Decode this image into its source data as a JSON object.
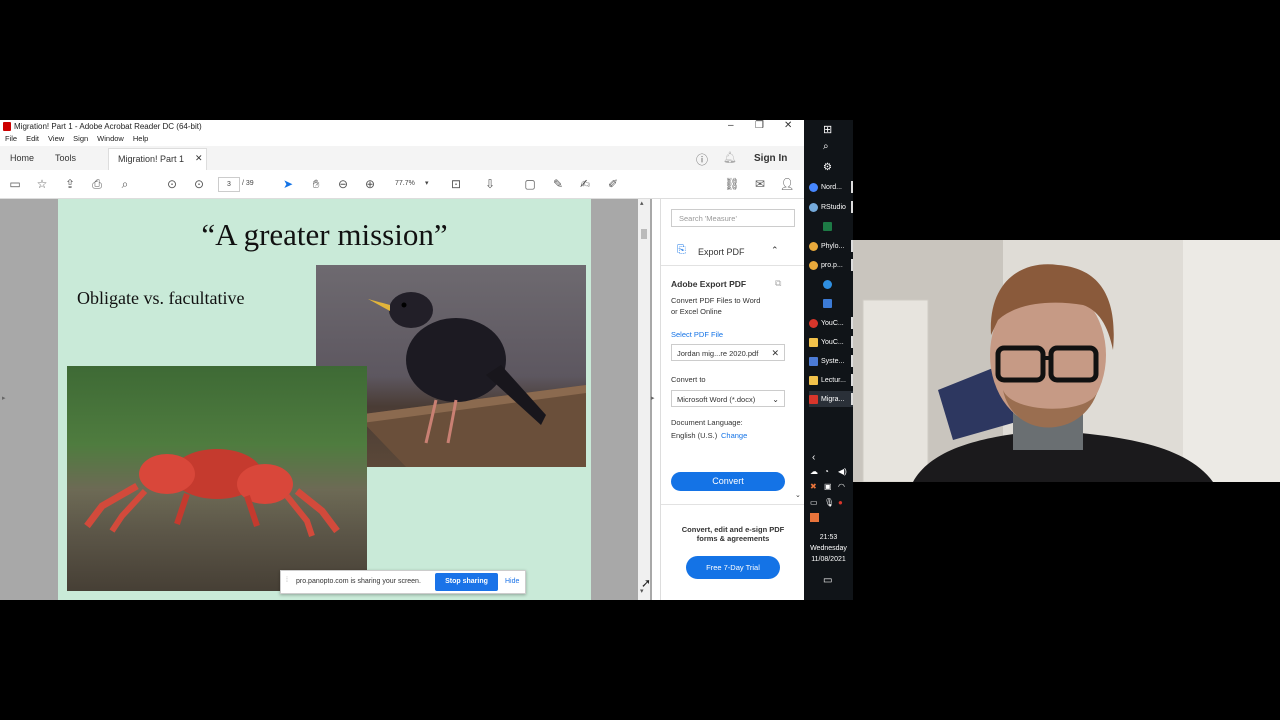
{
  "window": {
    "title": "Migration! Part 1 - Adobe Acrobat Reader DC (64-bit)",
    "menu": [
      "File",
      "Edit",
      "View",
      "Sign",
      "Window",
      "Help"
    ]
  },
  "tabs": {
    "home": "Home",
    "tools": "Tools",
    "doc": "Migration! Part 1",
    "sign_in": "Sign In"
  },
  "toolbar": {
    "page_current": "3",
    "page_total": "/ 39",
    "zoom": "77.7%"
  },
  "slide": {
    "title": "“A greater mission”",
    "subtitle": "Obligate vs. facultative"
  },
  "panel": {
    "search_placeholder": "Search 'Measure'",
    "export_title": "Export PDF",
    "heading": "Adobe Export PDF",
    "desc_line1": "Convert PDF Files to Word",
    "desc_line2": "or Excel Online",
    "select_label": "Select PDF File",
    "file_name": "Jordan mig...re 2020.pdf",
    "convert_to_label": "Convert to",
    "convert_to_value": "Microsoft Word (*.docx)",
    "doc_lang_label": "Document Language:",
    "doc_lang_value": "English (U.S.)",
    "change_link": "Change",
    "convert_button": "Convert",
    "promo_line1": "Convert, edit and e-sign PDF",
    "promo_line2": "forms & agreements",
    "trial_button": "Free 7-Day Trial"
  },
  "share": {
    "message": "pro.panopto.com is sharing your screen.",
    "stop": "Stop sharing",
    "hide": "Hide"
  },
  "taskbar": {
    "apps": [
      {
        "label": "Nord...",
        "color": "#4687ff"
      },
      {
        "label": "RStudio",
        "color": "#75aadb"
      },
      {
        "label": "",
        "color": "#1d7a45"
      },
      {
        "label": "Phylo...",
        "color": "#e8a93b"
      },
      {
        "label": "pro.p...",
        "color": "#e8a93b"
      },
      {
        "label": "",
        "color": "#2f8fe0"
      },
      {
        "label": "",
        "color": "#3c7bd6"
      },
      {
        "label": "YouC...",
        "color": "#d8362b"
      },
      {
        "label": "YouC...",
        "color": "#f2c24b"
      },
      {
        "label": "Syste...",
        "color": "#4c7bd6"
      },
      {
        "label": "Lectur...",
        "color": "#f2c24b"
      },
      {
        "label": "Migra...",
        "color": "#d8362b"
      }
    ],
    "time": "21:53",
    "day": "Wednesday",
    "date": "11/08/2021"
  }
}
